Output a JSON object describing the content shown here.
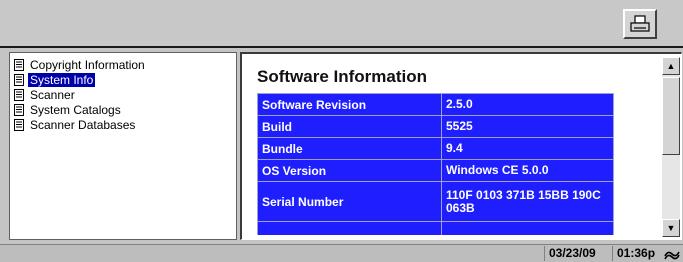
{
  "toolbar": {
    "print_icon": "printer-icon"
  },
  "tree": {
    "items": [
      {
        "label": "Copyright Information",
        "selected": false
      },
      {
        "label": "System Info",
        "selected": true
      },
      {
        "label": "Scanner",
        "selected": false
      },
      {
        "label": "System Catalogs",
        "selected": false
      },
      {
        "label": "Scanner Databases",
        "selected": false
      }
    ]
  },
  "content": {
    "title": "Software Information",
    "rows": [
      {
        "key": "Software Revision",
        "value": "2.5.0"
      },
      {
        "key": "Build",
        "value": "5525"
      },
      {
        "key": "Bundle",
        "value": "9.4"
      },
      {
        "key": "OS Version",
        "value": "Windows CE 5.0.0"
      },
      {
        "key": "Serial Number",
        "value": "110F 0103 371B 15BB 190C 063B"
      },
      {
        "key": "",
        "value": ""
      }
    ]
  },
  "status": {
    "date": "03/23/09",
    "time": "01:36p",
    "icon": "connection-wave-icon"
  },
  "colors": {
    "table_cell": "#1e1eff",
    "selection": "#0000aa",
    "chrome": "#c4c4c4"
  }
}
